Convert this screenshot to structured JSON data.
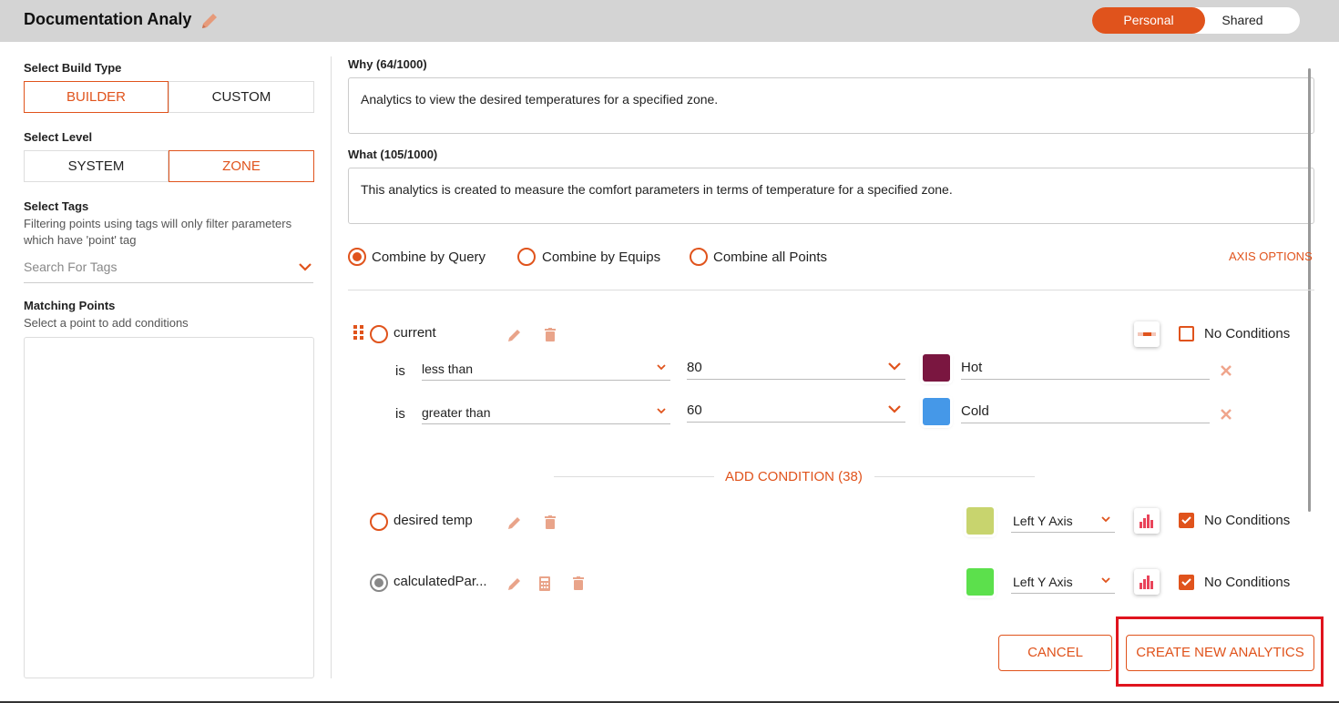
{
  "header": {
    "title": "Documentation Analy",
    "toggle": {
      "personal": "Personal",
      "shared": "Shared",
      "selected": "Personal"
    }
  },
  "left": {
    "build_type_label": "Select Build Type",
    "build_types": [
      "BUILDER",
      "CUSTOM"
    ],
    "build_selected": "BUILDER",
    "level_label": "Select Level",
    "levels": [
      "SYSTEM",
      "ZONE"
    ],
    "level_selected": "ZONE",
    "tags_label": "Select Tags",
    "tags_help": "Filtering points using tags will only filter parameters which have 'point' tag",
    "tags_placeholder": "Search For Tags",
    "matching_label": "Matching Points",
    "matching_help": "Select a point to add conditions"
  },
  "main": {
    "why_label": "Why (64/1000)",
    "why_text": "Analytics to view the desired temperatures for a specified zone.",
    "what_label": "What (105/1000)",
    "what_text": "This analytics is created to measure the comfort parameters in terms of temperature for a specified zone.",
    "combine_options": [
      "Combine by Query",
      "Combine by Equips",
      "Combine all Points"
    ],
    "combine_selected": "Combine by Query",
    "axis_options": "AXIS OPTIONS",
    "points": [
      {
        "name": "current",
        "no_conditions_label": "No Conditions",
        "no_conditions_checked": false,
        "conditions": [
          {
            "is": "is",
            "operator": "less than",
            "value": "80",
            "color": "#7a1640",
            "label": "Hot"
          },
          {
            "is": "is",
            "operator": "greater than",
            "value": "60",
            "color": "#4598e8",
            "label": "Cold"
          }
        ]
      },
      {
        "name": "desired temp",
        "color": "#c8d46e",
        "axis": "Left Y Axis",
        "no_conditions_label": "No Conditions",
        "no_conditions_checked": true
      },
      {
        "name": "calculatedPar...",
        "color": "#5ce04c",
        "axis": "Left Y Axis",
        "no_conditions_label": "No Conditions",
        "no_conditions_checked": true
      }
    ],
    "add_condition": "ADD CONDITION (38)"
  },
  "footer": {
    "cancel": "CANCEL",
    "create": "CREATE NEW ANALYTICS"
  },
  "colors": {
    "accent": "#e0531c",
    "highlight": "#e0141e"
  },
  "icons": [
    "pencil-icon",
    "trash-icon",
    "drag-handle-icon",
    "calculator-icon",
    "bar-chart-icon",
    "gradient-bar-icon",
    "close-icon",
    "chevron-down-icon",
    "checkmark-icon"
  ]
}
